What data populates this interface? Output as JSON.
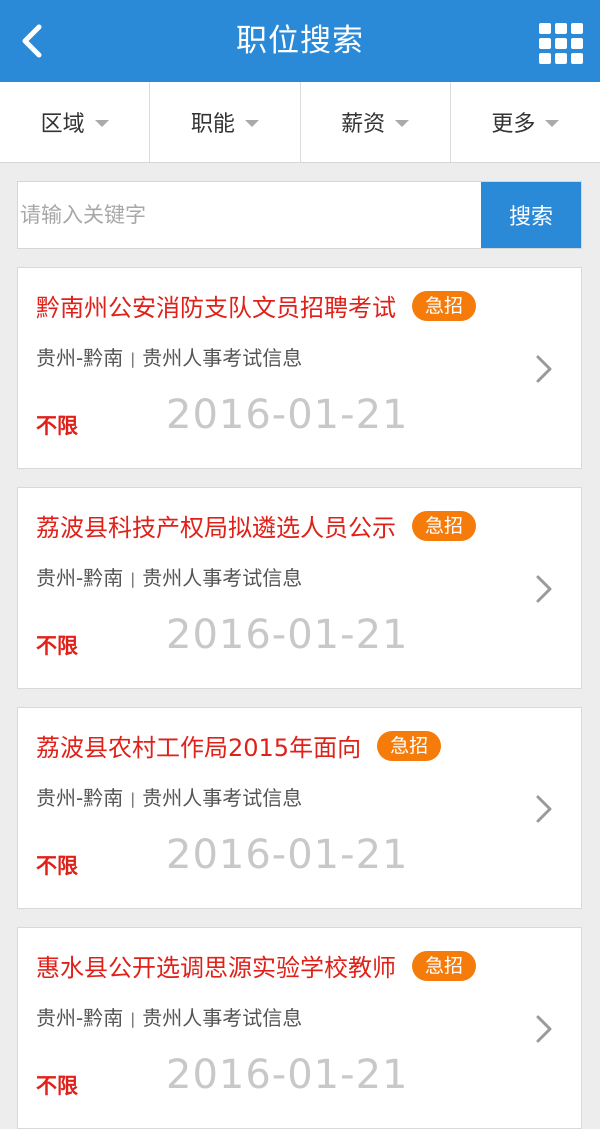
{
  "header": {
    "title": "职位搜索",
    "back_icon": "chevron-left-icon",
    "menu_icon": "grid-icon",
    "color": "#2b8ad8"
  },
  "filters": [
    {
      "label": "区域"
    },
    {
      "label": "职能"
    },
    {
      "label": "薪资"
    },
    {
      "label": "更多"
    }
  ],
  "search": {
    "placeholder": "请输入关键字",
    "value": "",
    "button_label": "搜索"
  },
  "jobs": [
    {
      "title": "黔南州公安消防支队文员招聘考试",
      "badge": "急招",
      "location": "贵州-黔南",
      "source": "贵州人事考试信息",
      "salary": "不限",
      "date": "2016-01-21"
    },
    {
      "title": "荔波县科技产权局拟遴选人员公示",
      "badge": "急招",
      "location": "贵州-黔南",
      "source": "贵州人事考试信息",
      "salary": "不限",
      "date": "2016-01-21"
    },
    {
      "title": "荔波县农村工作局2015年面向",
      "badge": "急招",
      "location": "贵州-黔南",
      "source": "贵州人事考试信息",
      "salary": "不限",
      "date": "2016-01-21"
    },
    {
      "title": "惠水县公开选调思源实验学校教师",
      "badge": "急招",
      "location": "贵州-黔南",
      "source": "贵州人事考试信息",
      "salary": "不限",
      "date": "2016-01-21"
    }
  ],
  "colors": {
    "accent": "#2b8ad8",
    "title_red": "#e0211a",
    "badge_orange": "#f57c0b",
    "date_gray": "#c8c8c8"
  }
}
